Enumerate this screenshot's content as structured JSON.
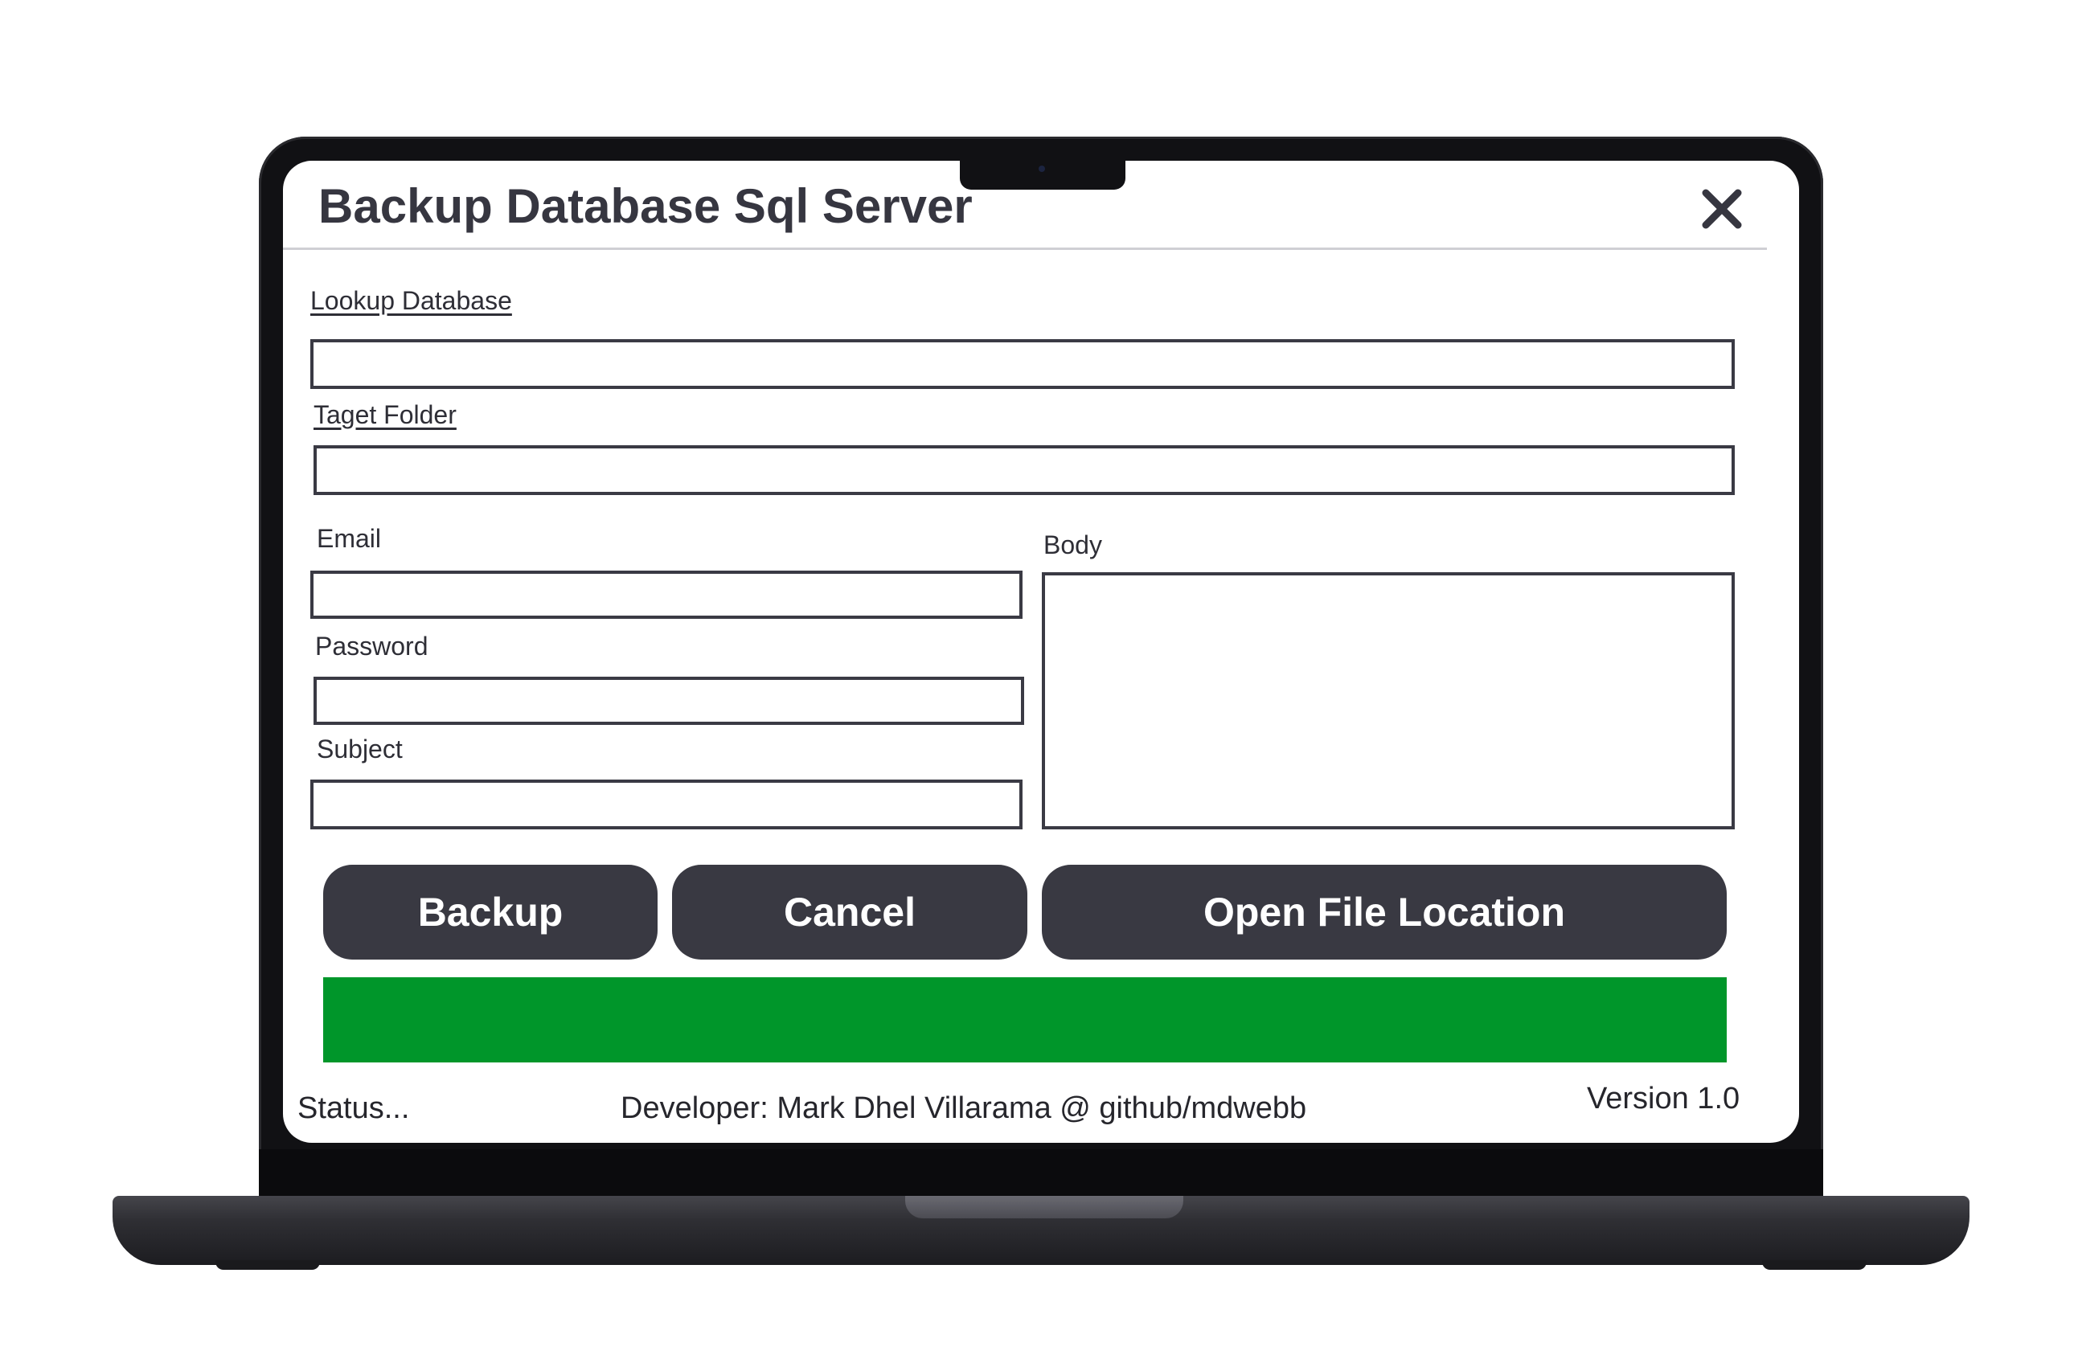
{
  "window": {
    "title": "Backup Database Sql Server",
    "close_icon": "close-icon"
  },
  "form": {
    "lookup_label": "Lookup Database",
    "lookup_value": "",
    "target_label": "Taget Folder",
    "target_value": "",
    "email_label": "Email",
    "email_value": "",
    "password_label": "Password",
    "password_value": "",
    "subject_label": "Subject",
    "subject_value": "",
    "body_label": "Body",
    "body_value": ""
  },
  "buttons": {
    "backup": "Backup",
    "cancel": "Cancel",
    "open_location": "Open File Location"
  },
  "progress": {
    "percent": 100,
    "color": "#00962a"
  },
  "footer": {
    "status": "Status...",
    "developer": "Developer: Mark Dhel Villarama @ github/mdwebb",
    "version": "Version 1.0"
  },
  "colors": {
    "button_bg": "#393942",
    "title_text": "#363640",
    "field_border": "#3a3a44"
  }
}
